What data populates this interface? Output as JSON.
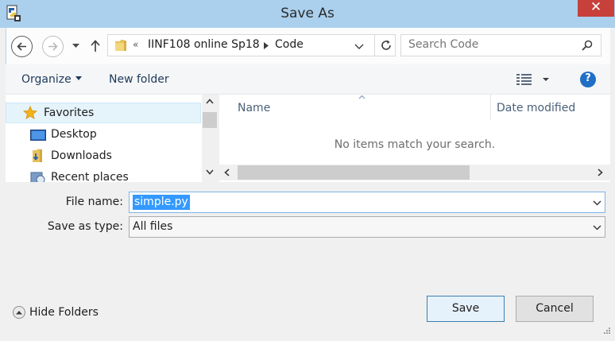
{
  "window": {
    "title": "Save As",
    "close_glyph": "✕"
  },
  "address_bar": {
    "overflow_chevron": "«",
    "path": [
      "IINF108 online Sp18",
      "Code"
    ]
  },
  "search": {
    "placeholder": "Search Code"
  },
  "toolbar": {
    "organize_label": "Organize",
    "new_folder_label": "New folder",
    "help_glyph": "?"
  },
  "navigation": {
    "items": [
      {
        "label": "Favorites",
        "icon": "star-icon",
        "selected": true
      },
      {
        "label": "Desktop",
        "icon": "desktop-icon"
      },
      {
        "label": "Downloads",
        "icon": "downloads-folder-icon"
      },
      {
        "label": "Recent places",
        "icon": "recent-places-icon"
      }
    ]
  },
  "file_list": {
    "columns": [
      "Name",
      "Date modified"
    ],
    "empty_message": "No items match your search."
  },
  "form": {
    "file_name_label": "File name:",
    "file_name_value": "simple.py",
    "save_type_label": "Save as type:",
    "save_type_value": "All files"
  },
  "buttons": {
    "hide_folders_label": "Hide Folders",
    "save_label": "Save",
    "cancel_label": "Cancel"
  },
  "colors": {
    "title_bar": "#aad0ee",
    "close_button": "#c7413a",
    "selection": "#3399ff",
    "default_button_border": "#3c7fb1"
  }
}
